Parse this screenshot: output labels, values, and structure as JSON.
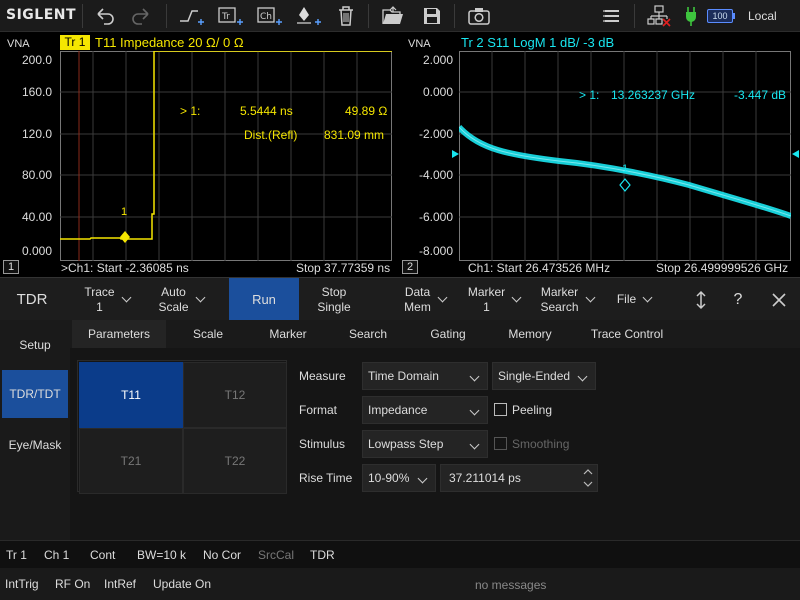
{
  "toolbar": {
    "logo": "SIGLENT",
    "icons": [
      "undo-icon",
      "redo-icon",
      "step-add-icon",
      "trace-add-icon",
      "channel-add-icon",
      "marker-add-icon",
      "delete-icon",
      "open-folder-icon",
      "save-icon",
      "camera-icon",
      "menu-icon",
      "network-icon",
      "power-plug-icon",
      "battery-icon"
    ],
    "battery_level": "100",
    "local_label": "Local"
  },
  "left_plot": {
    "vna_label": "VNA",
    "trace_tag": "Tr 1",
    "trace_title": "T11  Impedance  20 Ω/  0 Ω",
    "yticks": [
      "200.0",
      "160.0",
      "120.0",
      "80.00",
      "40.00",
      "0.000"
    ],
    "marker_readout": {
      "id": "> 1:",
      "x": "5.5444 ns",
      "y": "49.89 Ω"
    },
    "dist_readout": {
      "label": "Dist.(Refl)",
      "value": "831.09 mm"
    },
    "marker_label": "1",
    "window_num": "1",
    "start": ">Ch1: Start -2.36085 ns",
    "stop": "Stop 37.77359 ns",
    "trace_color": "#f5e600"
  },
  "right_plot": {
    "vna_label": "VNA",
    "trace_title": "Tr 2   S11  LogM  1 dB/  -3 dB",
    "yticks": [
      "2.000",
      "0.000",
      "-2.000",
      "-4.000",
      "-6.000",
      "-8.000"
    ],
    "marker_readout": {
      "id": "> 1:",
      "x": "13.263237 GHz",
      "y": "-3.447 dB"
    },
    "marker_label": "1",
    "window_num": "2",
    "start": "Ch1: Start 26.473526 MHz",
    "stop": "Stop 26.499999526 GHz",
    "trace_color": "#19e6f0"
  },
  "softkeys": {
    "title": "TDR",
    "trace": [
      "Trace",
      "1"
    ],
    "auto_scale": [
      "Auto",
      "Scale"
    ],
    "run": "Run",
    "stop_single": [
      "Stop",
      "Single"
    ],
    "data_mem": [
      "Data",
      "Mem"
    ],
    "marker": [
      "Marker",
      "1"
    ],
    "marker_search": [
      "Marker",
      "Search"
    ],
    "file": "File",
    "help": "?"
  },
  "left_tabs": [
    "Setup",
    "TDR/TDT",
    "Eye/Mask"
  ],
  "sub_tabs": [
    "Parameters",
    "Scale",
    "Marker",
    "Search",
    "Gating",
    "Memory",
    "Trace Control"
  ],
  "tparams": [
    "T11",
    "T12",
    "T21",
    "T22"
  ],
  "form": {
    "measure_label": "Measure",
    "measure_value": "Time Domain",
    "ended_value": "Single-Ended",
    "format_label": "Format",
    "format_value": "Impedance",
    "peeling_label": "Peeling",
    "stimulus_label": "Stimulus",
    "stimulus_value": "Lowpass Step",
    "smoothing_label": "Smoothing",
    "rise_label": "Rise Time",
    "rise_pct": "10-90%",
    "rise_value": "37.211014 ps"
  },
  "status1": [
    "Tr 1",
    "Ch 1",
    "Cont",
    "BW=10 k",
    "No Cor",
    "SrcCal",
    "TDR"
  ],
  "status2": [
    "IntTrig",
    "RF On",
    "IntRef",
    "Update On"
  ],
  "message": "no messages",
  "colors": {
    "accent": "#0b3c8a",
    "run": "#1b4f9c",
    "yellow": "#f5e600",
    "cyan": "#19e6f0"
  }
}
